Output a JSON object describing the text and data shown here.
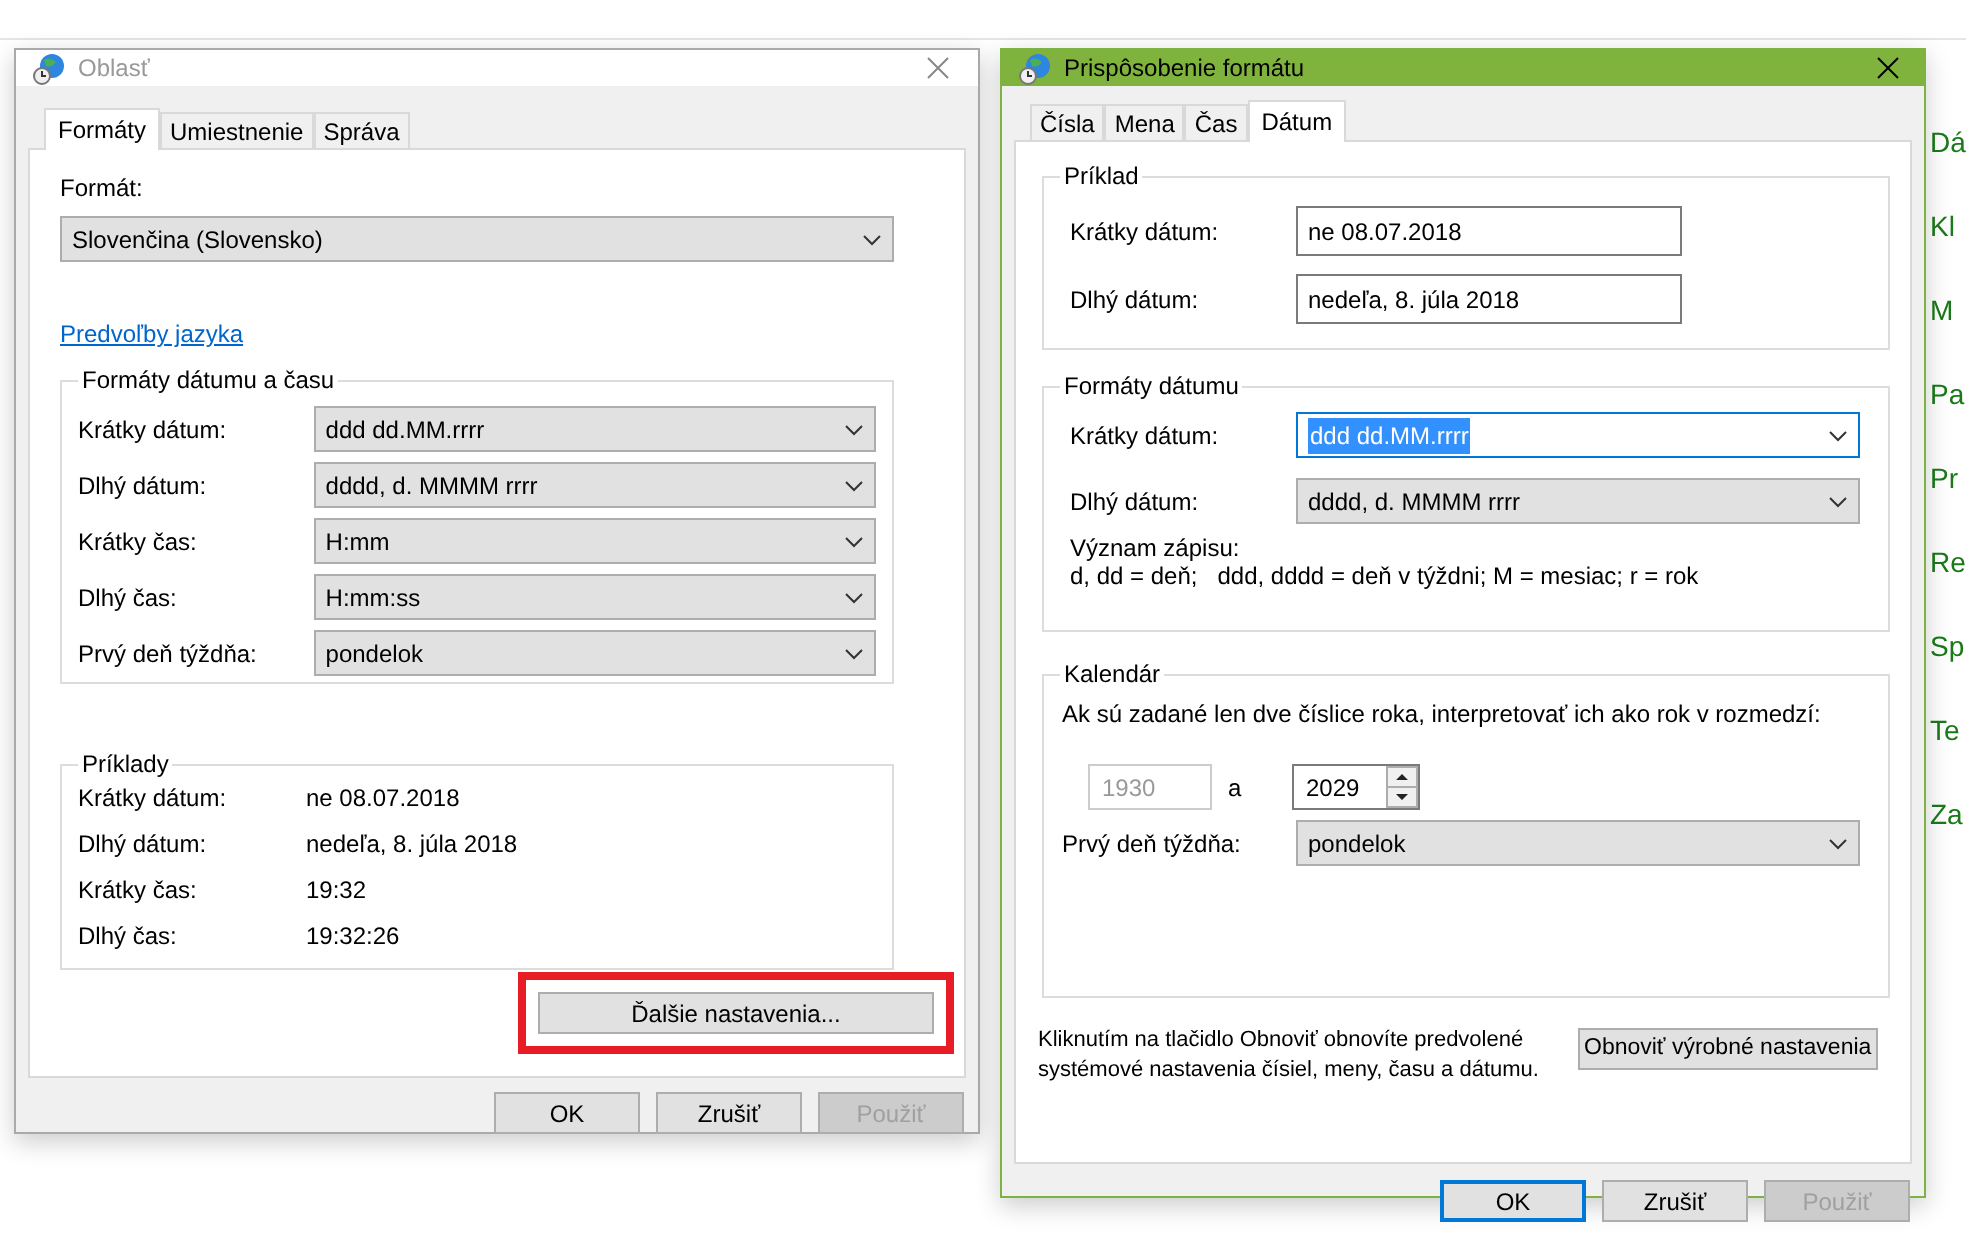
{
  "background_text": {
    "right": [
      "Dá",
      "Kl",
      "M",
      "Pa",
      "Pr",
      "Re",
      "Sp",
      "Te",
      "Za"
    ]
  },
  "region_window": {
    "title": "Oblasť",
    "tabs": [
      {
        "label": "Formáty",
        "selected": true
      },
      {
        "label": "Umiestnenie",
        "selected": false
      },
      {
        "label": "Správa",
        "selected": false
      }
    ],
    "format_label": "Formát:",
    "format_value": "Slovenčina (Slovensko)",
    "link": "Predvoľby jazyka",
    "formats_group": {
      "title": "Formáty dátumu a času",
      "rows": [
        {
          "label": "Krátky dátum:",
          "value": "ddd dd.MM.rrrr"
        },
        {
          "label": "Dlhý dátum:",
          "value": "dddd, d. MMMM rrrr"
        },
        {
          "label": "Krátky čas:",
          "value": "H:mm"
        },
        {
          "label": "Dlhý čas:",
          "value": "H:mm:ss"
        },
        {
          "label": "Prvý deň týždňa:",
          "value": "pondelok"
        }
      ]
    },
    "examples_group": {
      "title": "Príklady",
      "rows": [
        {
          "label": "Krátky dátum:",
          "value": "ne 08.07.2018"
        },
        {
          "label": "Dlhý dátum:",
          "value": "nedeľa, 8. júla 2018"
        },
        {
          "label": "Krátky čas:",
          "value": "19:32"
        },
        {
          "label": "Dlhý čas:",
          "value": "19:32:26"
        }
      ]
    },
    "more_button": {
      "label": "Ďalšie nastavenia...",
      "highlighted": true
    },
    "buttons": [
      {
        "label": "OK",
        "disabled": false
      },
      {
        "label": "Zrušiť",
        "disabled": false
      },
      {
        "label": "Použiť",
        "disabled": true
      }
    ]
  },
  "format_window": {
    "title": "Prispôsobenie formátu",
    "tabs": [
      {
        "label": "Čísla",
        "selected": false
      },
      {
        "label": "Mena",
        "selected": false
      },
      {
        "label": "Čas",
        "selected": false
      },
      {
        "label": "Dátum",
        "selected": true
      }
    ],
    "example_group": {
      "title": "Príklad",
      "rows": [
        {
          "label": "Krátky dátum:",
          "value": "ne 08.07.2018"
        },
        {
          "label": "Dlhý dátum:",
          "value": "nedeľa, 8. júla 2018"
        }
      ]
    },
    "formats_group": {
      "title": "Formáty dátumu",
      "rows": [
        {
          "label": "Krátky dátum:",
          "value": "ddd dd.MM.rrrr",
          "focused": true
        },
        {
          "label": "Dlhý dátum:",
          "value": "dddd, d. MMMM rrrr",
          "focused": false
        }
      ],
      "legend_title": "Význam zápisu:",
      "legend": "d, dd = deň;   ddd, dddd = deň v týždni; M = mesiac; r = rok"
    },
    "calendar_group": {
      "title": "Kalendár",
      "instruction": "Ak sú zadané len dve číslice roka, interpretovať ich ako rok v rozmedzí:",
      "year_from": "1930",
      "year_separator": "a",
      "year_to": "2029",
      "first_day_label": "Prvý deň týždňa:",
      "first_day_value": "pondelok"
    },
    "reset_note": "Kliknutím na tlačidlo Obnoviť obnovíte predvolené systémové nastavenia čísiel, meny, času a dátumu.",
    "reset_button": "Obnoviť výrobné nastavenia",
    "buttons": [
      {
        "label": "OK",
        "disabled": false,
        "default": true
      },
      {
        "label": "Zrušiť",
        "disabled": false,
        "default": false
      },
      {
        "label": "Použiť",
        "disabled": true,
        "default": false
      }
    ]
  }
}
